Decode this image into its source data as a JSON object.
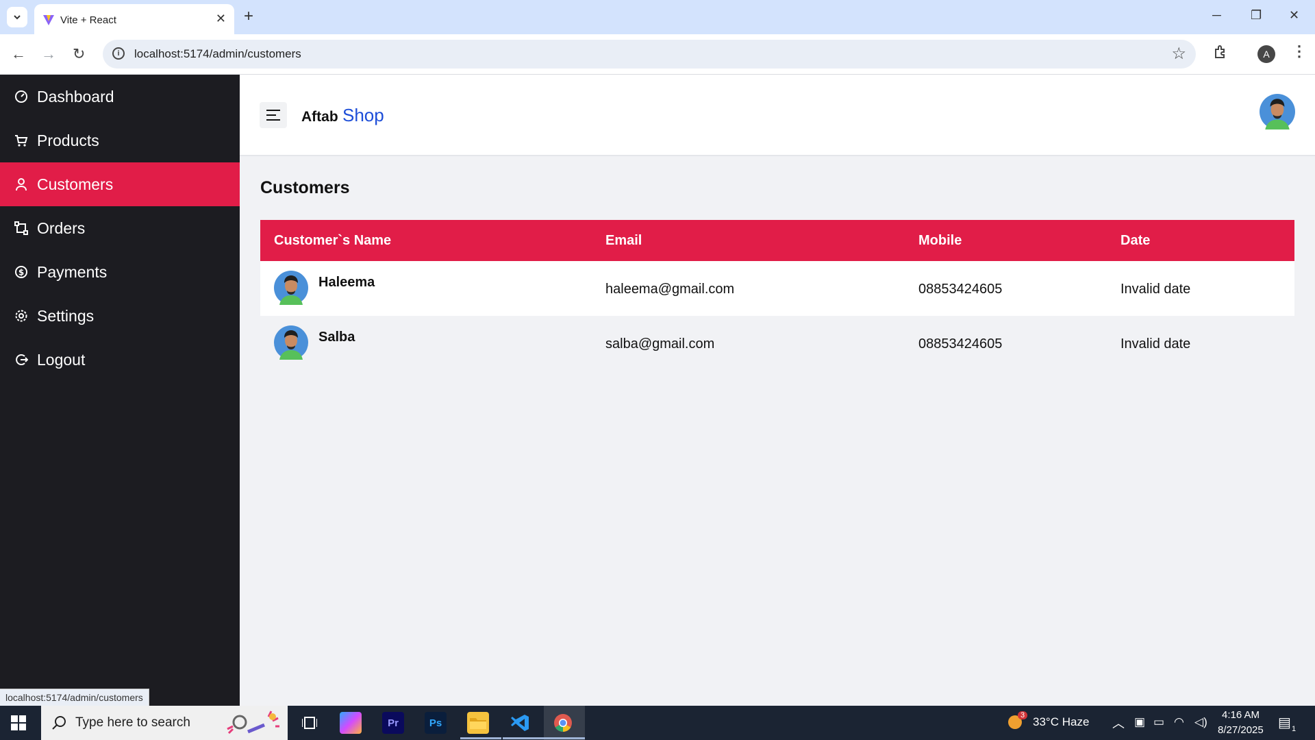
{
  "browser": {
    "tab_title": "Vite + React",
    "url": "localhost:5174/admin/customers",
    "profile_initial": "A",
    "status_url": "localhost:5174/admin/customers"
  },
  "sidebar": {
    "items": [
      {
        "label": "Dashboard",
        "icon": "gauge-icon"
      },
      {
        "label": "Products",
        "icon": "cart-icon"
      },
      {
        "label": "Customers",
        "icon": "user-icon",
        "active": true
      },
      {
        "label": "Orders",
        "icon": "orders-icon"
      },
      {
        "label": "Payments",
        "icon": "dollar-icon"
      },
      {
        "label": "Settings",
        "icon": "gear-icon"
      },
      {
        "label": "Logout",
        "icon": "logout-icon"
      }
    ]
  },
  "header": {
    "brand_first": "Aftab",
    "brand_second": "Shop"
  },
  "main": {
    "title": "Customers",
    "table": {
      "headers": [
        "Customer`s Name",
        "Email",
        "Mobile",
        "Date"
      ],
      "rows": [
        {
          "name": "Haleema",
          "email": "haleema@gmail.com",
          "mobile": "08853424605",
          "date": "Invalid date"
        },
        {
          "name": "Salba",
          "email": "salba@gmail.com",
          "mobile": "08853424605",
          "date": "Invalid date"
        }
      ]
    }
  },
  "taskbar": {
    "search_placeholder": "Type here to search",
    "weather": "33°C  Haze",
    "weather_badge": "3",
    "time": "4:16 AM",
    "date": "8/27/2025",
    "notification_count": "1"
  },
  "colors": {
    "accent": "#e11d48",
    "sidebar_bg": "#1c1c21",
    "brand_blue": "#1d4ed8"
  }
}
